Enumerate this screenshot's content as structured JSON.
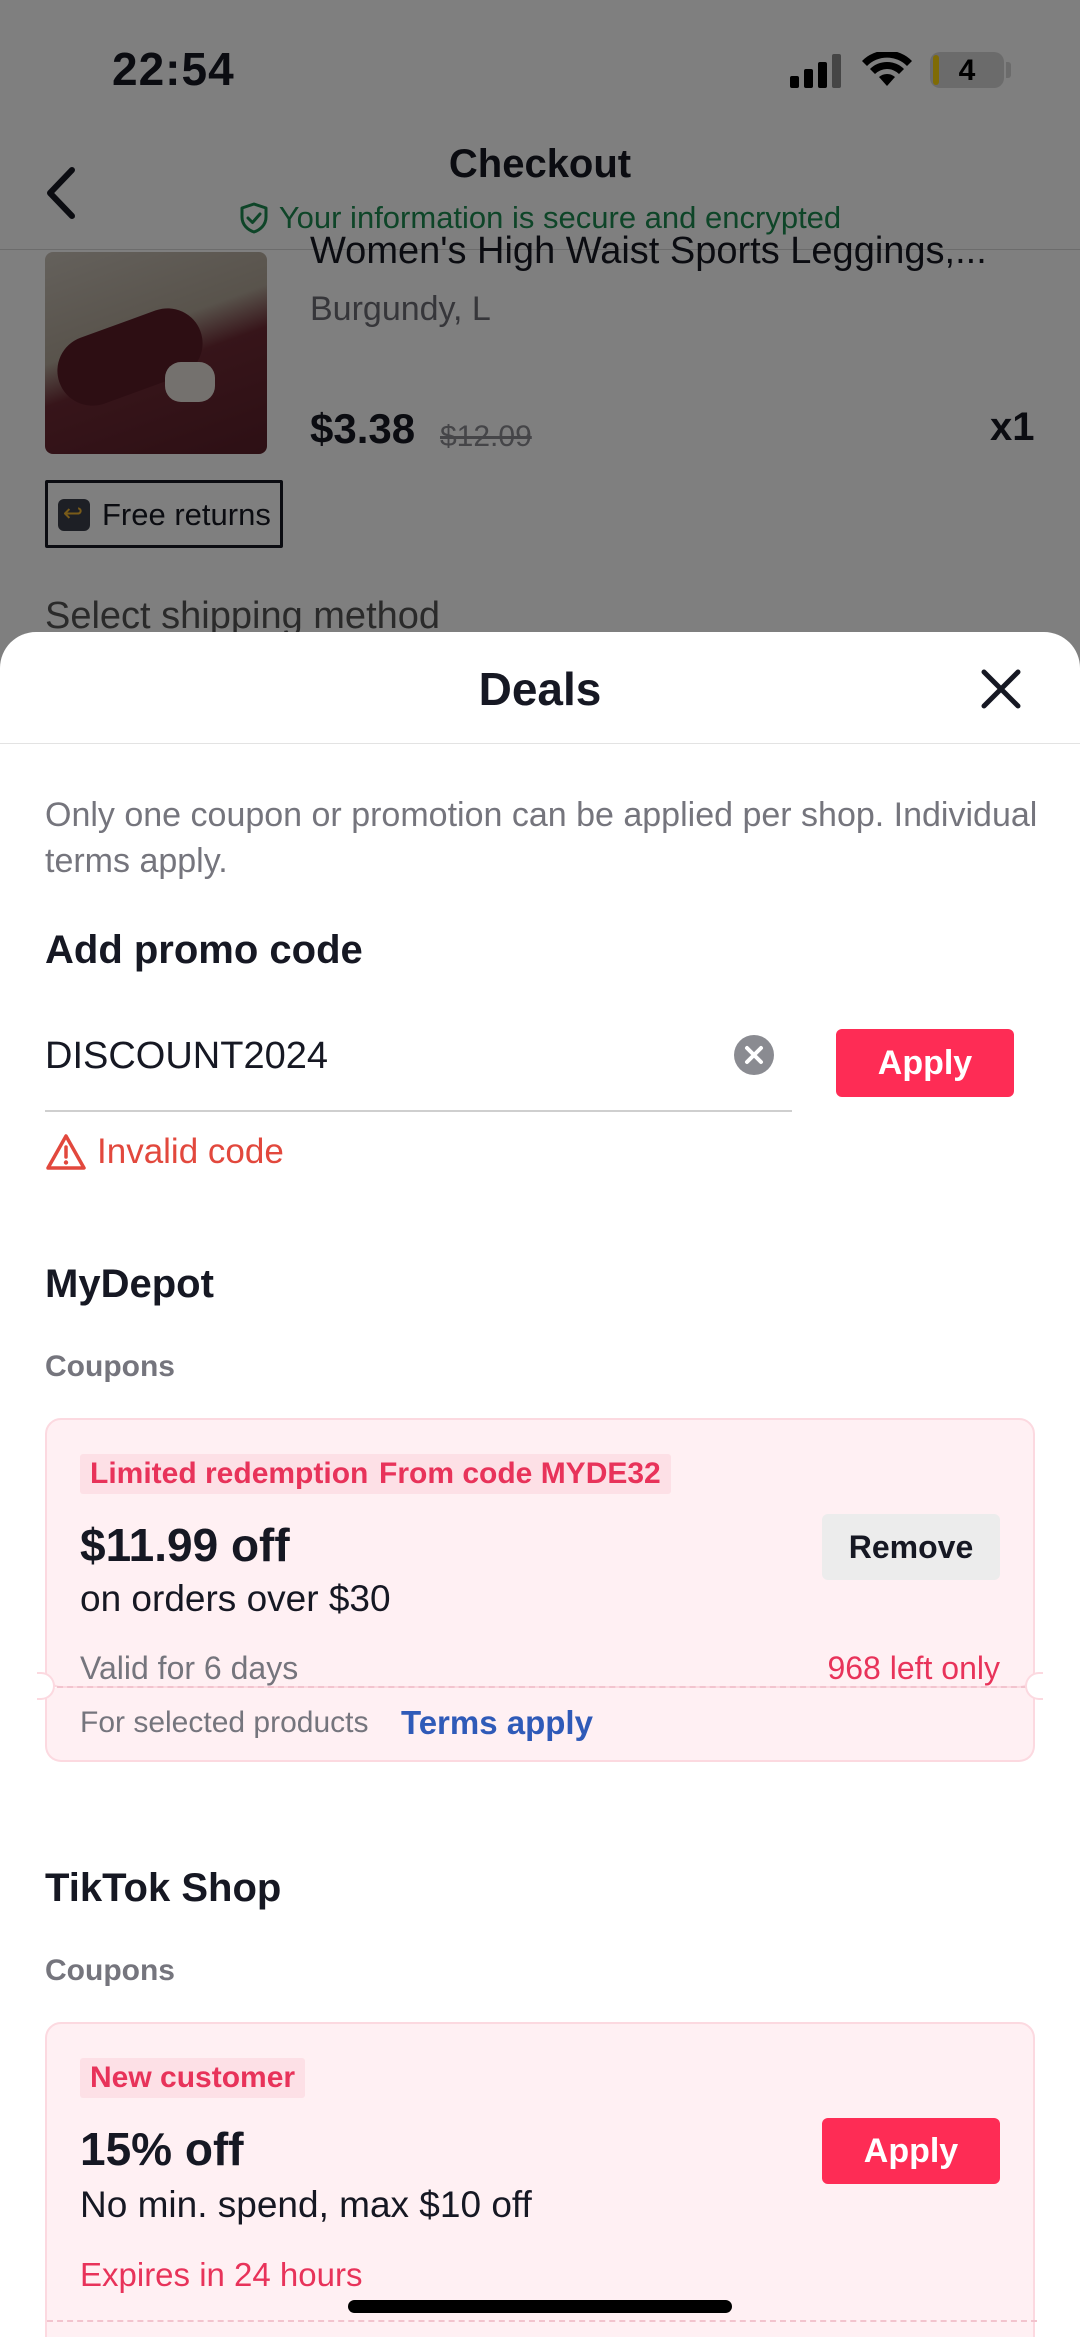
{
  "status_bar": {
    "time": "22:54",
    "battery": "4"
  },
  "header": {
    "title": "Checkout",
    "secure_text": "Your information is secure and encrypted"
  },
  "product": {
    "name": "Women's High Waist Sports Leggings,...",
    "variant": "Burgundy, L",
    "price": "$3.38",
    "original_price": "$12.09",
    "quantity": "x1",
    "badge": "Free returns"
  },
  "shipping": {
    "title": "Select shipping method"
  },
  "sheet": {
    "title": "Deals",
    "notice": "Only one coupon or promotion can be applied per shop. Individual terms apply.",
    "promo": {
      "heading": "Add promo code",
      "value": "DISCOUNT2024",
      "apply_label": "Apply",
      "error": "Invalid code"
    },
    "shops": [
      {
        "name": "MyDepot",
        "section": "Coupons",
        "coupon": {
          "tags": [
            "Limited redemption",
            "From code MYDE32"
          ],
          "amount": "$11.99 off",
          "condition": "on orders over $30",
          "validity": "Valid for 6 days",
          "remaining": "968 left only",
          "action": "Remove",
          "footer": "For selected products",
          "terms": "Terms apply"
        }
      },
      {
        "name": "TikTok Shop",
        "section": "Coupons",
        "coupon": {
          "tags": [
            "New customer"
          ],
          "amount": "15% off",
          "condition": "No min. spend, max $10 off",
          "expiry": "Expires in 24 hours",
          "action": "Apply"
        }
      }
    ]
  },
  "colors": {
    "accent": "#fe2c55",
    "secure_green": "#1c8a50",
    "error_red": "#e2483d",
    "link_blue": "#2f5ab8",
    "coupon_bg": "#fff0f3"
  }
}
